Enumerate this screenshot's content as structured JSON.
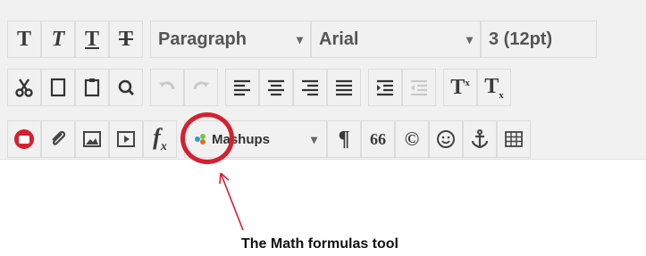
{
  "toolbar": {
    "row1": {
      "bold": "T",
      "italic": "T",
      "underline": "T",
      "strikethrough": "T",
      "paragraph_select": "Paragraph",
      "font_select": "Arial",
      "size_select": "3 (12pt)"
    },
    "row2": {
      "superscript_label": "T",
      "superscript_mark": "x",
      "subscript_label": "T",
      "subscript_mark": "x"
    },
    "row3": {
      "math_label": "f",
      "math_sub": "x",
      "mashups_label": "Mashups",
      "pilcrow": "¶",
      "quote": "66",
      "copyright": "©"
    }
  },
  "annotation": {
    "caption": "The Math formulas tool"
  },
  "colors": {
    "toolbar_bg": "#f1f1f1",
    "highlight": "#d6202f",
    "record_button": "#d6202f"
  }
}
